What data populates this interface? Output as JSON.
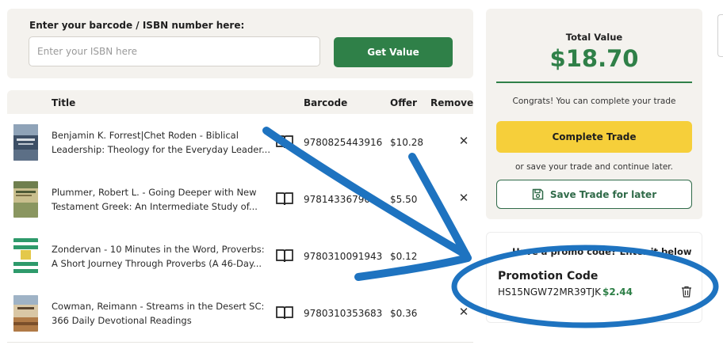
{
  "search": {
    "label": "Enter your barcode / ISBN number here:",
    "placeholder": "Enter your ISBN here",
    "value": "",
    "button_label": "Get Value"
  },
  "table": {
    "headers": {
      "title": "Title",
      "barcode": "Barcode",
      "offer": "Offer",
      "remove": "Remove"
    },
    "rows": [
      {
        "title_line1": "Benjamin K. Forrest|Chet Roden - Biblical",
        "title_line2": "Leadership: Theology for the Everyday Leader...",
        "barcode": "9780825443916",
        "offer": "$10.28"
      },
      {
        "title_line1": "Plummer, Robert L. - Going Deeper with New",
        "title_line2": "Testament Greek: An Intermediate Study of...",
        "barcode": "978143367900",
        "offer": "$5.50"
      },
      {
        "title_line1": "Zondervan - 10 Minutes in the Word, Proverbs:",
        "title_line2": "A Short Journey Through Proverbs (A 46-Day...",
        "barcode": "9780310091943",
        "offer": "$0.12"
      },
      {
        "title_line1": "Cowman, Reimann - Streams in the Desert SC:",
        "title_line2": "366 Daily Devotional Readings",
        "barcode": "9780310353683",
        "offer": "$0.36"
      }
    ],
    "remove_icon": "close-icon",
    "details_icon": "open-book-icon"
  },
  "summary": {
    "total_label": "Total Value",
    "total_value": "$18.70",
    "congrats": "Congrats! You can complete your trade",
    "complete_label": "Complete Trade",
    "save_note": "or save your trade and continue later.",
    "save_label": "Save Trade for later",
    "save_icon": "floppy-disk-icon"
  },
  "promo": {
    "prompt": "Have a promo code? Enter it below",
    "title": "Promotion Code",
    "code": "HS15NGW72MR39TJK",
    "amount": "$2.44",
    "delete_icon": "trash-icon"
  },
  "colors": {
    "brand_green": "#2f8048",
    "accent_yellow": "#f6cf3a",
    "panel_bg": "#f4f2ee",
    "annotation_blue": "#1e73c0"
  }
}
